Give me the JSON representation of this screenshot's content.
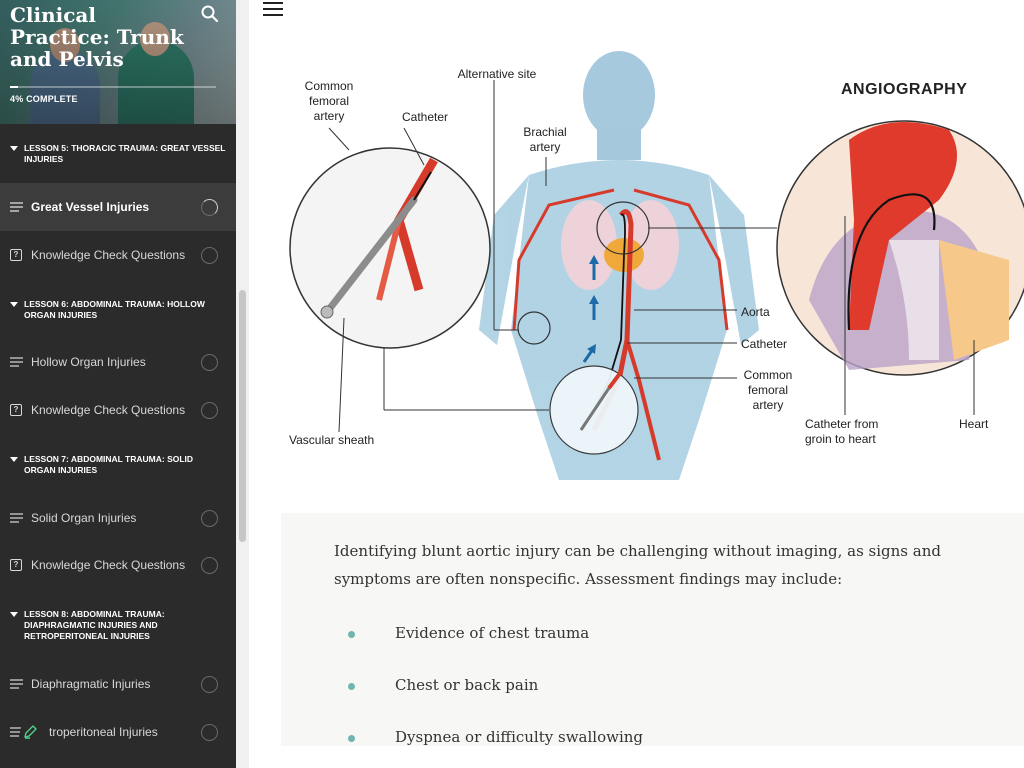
{
  "sidebar": {
    "course_title": "Clinical Practice: Trunk and Pelvis",
    "progress_label": "4% COMPLETE",
    "progress_fraction": 0.04,
    "lessons": [
      {
        "title": "LESSON 5: THORACIC TRAUMA: GREAT VESSEL INJURIES"
      },
      {
        "title": "LESSON 6: ABDOMINAL TRAUMA: HOLLOW ORGAN INJURIES"
      },
      {
        "title": "LESSON 7: ABDOMINAL TRAUMA: SOLID ORGAN INJURIES"
      },
      {
        "title": "LESSON 8: ABDOMINAL TRAUMA: DIAPHRAGMATIC INJURIES AND RETROPERITONEAL INJURIES"
      }
    ],
    "items": [
      {
        "label": "Great Vessel Injuries",
        "icon": "lines-icon",
        "status": "in-progress"
      },
      {
        "label": "Knowledge Check Questions",
        "icon": "quiz-icon",
        "status": "not-started"
      },
      {
        "label": "Hollow Organ Injuries",
        "icon": "lines-icon",
        "status": "not-started"
      },
      {
        "label": "Knowledge Check Questions",
        "icon": "quiz-icon",
        "status": "not-started"
      },
      {
        "label": "Solid Organ Injuries",
        "icon": "lines-icon",
        "status": "not-started"
      },
      {
        "label": "Knowledge Check Questions",
        "icon": "quiz-icon",
        "status": "not-started"
      },
      {
        "label": "Diaphragmatic Injuries",
        "icon": "lines-icon",
        "status": "not-started"
      },
      {
        "label": "troperitoneal Injuries",
        "icon": "lines-icon",
        "status": "not-started"
      }
    ],
    "quiz_glyph": "?"
  },
  "illustration": {
    "labels": {
      "common_femoral_artery_left": "Common femoral artery",
      "catheter_top": "Catheter",
      "alternative_site": "Alternative site",
      "brachial_artery": "Brachial artery",
      "angiography": "ANGIOGRAPHY",
      "aorta": "Aorta",
      "catheter_right": "Catheter",
      "common_femoral_artery_right": "Common femoral artery",
      "vascular_sheath": "Vascular sheath",
      "catheter_from_groin": "Catheter from groin to heart",
      "heart": "Heart"
    }
  },
  "content": {
    "intro": "Identifying blunt aortic injury can be challenging without imaging, as signs and symptoms are often nonspecific. Assessment findings may include:",
    "bullets": [
      "Evidence of chest trauma",
      "Chest or back pain",
      "Dyspnea or difficulty swallowing"
    ]
  },
  "colors": {
    "sidebar_bg": "#2b2b2b",
    "accent_bullet": "#6fb5b0",
    "artery_red": "#e2442f"
  },
  "chart_data": {
    "type": "table",
    "title": "ANGIOGRAPHY",
    "annotations": [
      "Common femoral artery",
      "Catheter",
      "Alternative site",
      "Brachial artery",
      "Aorta",
      "Catheter",
      "Common femoral artery",
      "Vascular sheath",
      "Catheter from groin to heart",
      "Heart"
    ]
  }
}
